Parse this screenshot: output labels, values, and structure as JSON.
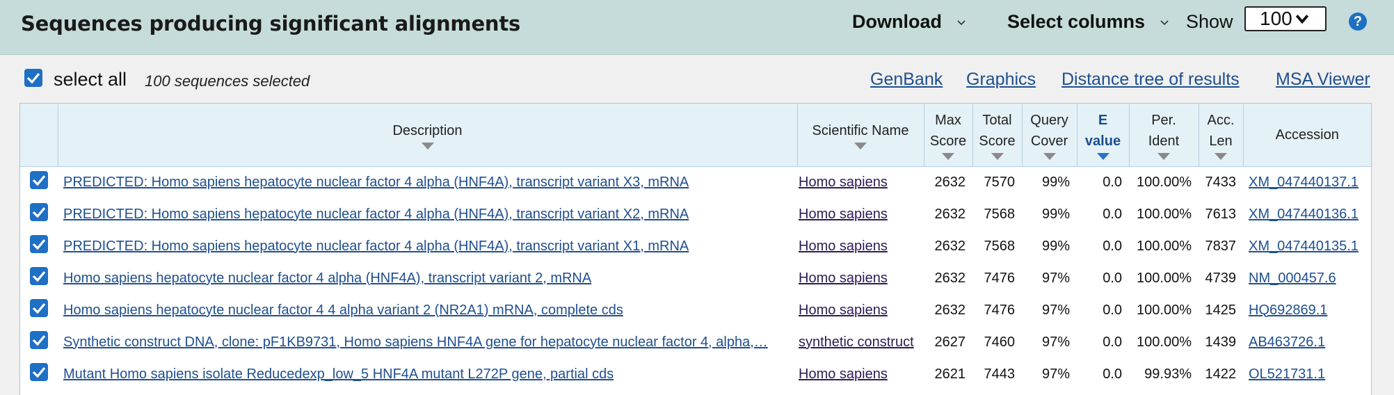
{
  "header": {
    "title": "Sequences producing significant alignments",
    "download_label": "Download",
    "select_columns_label": "Select columns",
    "show_label": "Show",
    "show_value": "100",
    "help_glyph": "?"
  },
  "toolbar": {
    "select_all_label": "select all",
    "selected_count": "100 sequences selected",
    "links": [
      "GenBank",
      "Graphics",
      "Distance tree of results",
      "MSA Viewer"
    ]
  },
  "columns": {
    "description": "Description",
    "scientific_name": "Scientific Name",
    "max_score": [
      "Max",
      "Score"
    ],
    "total_score": [
      "Total",
      "Score"
    ],
    "query_cover": [
      "Query",
      "Cover"
    ],
    "e_value": [
      "E",
      "value"
    ],
    "per_ident": [
      "Per.",
      "Ident"
    ],
    "acc_len": [
      "Acc.",
      "Len"
    ],
    "accession": "Accession"
  },
  "rows": [
    {
      "description": "PREDICTED: Homo sapiens hepatocyte nuclear factor 4 alpha (HNF4A), transcript variant X3, mRNA",
      "sci": "Homo sapiens",
      "max": "2632",
      "total": "7570",
      "cover": "99%",
      "evalue": "0.0",
      "ident": "100.00%",
      "len": "7433",
      "acc": "XM_047440137.1"
    },
    {
      "description": "PREDICTED: Homo sapiens hepatocyte nuclear factor 4 alpha (HNF4A), transcript variant X2, mRNA",
      "sci": "Homo sapiens",
      "max": "2632",
      "total": "7568",
      "cover": "99%",
      "evalue": "0.0",
      "ident": "100.00%",
      "len": "7613",
      "acc": "XM_047440136.1"
    },
    {
      "description": "PREDICTED: Homo sapiens hepatocyte nuclear factor 4 alpha (HNF4A), transcript variant X1, mRNA",
      "sci": "Homo sapiens",
      "max": "2632",
      "total": "7568",
      "cover": "99%",
      "evalue": "0.0",
      "ident": "100.00%",
      "len": "7837",
      "acc": "XM_047440135.1"
    },
    {
      "description": "Homo sapiens hepatocyte nuclear factor 4 alpha (HNF4A), transcript variant 2, mRNA",
      "sci": "Homo sapiens",
      "max": "2632",
      "total": "7476",
      "cover": "97%",
      "evalue": "0.0",
      "ident": "100.00%",
      "len": "4739",
      "acc": "NM_000457.6"
    },
    {
      "description": "Homo sapiens hepatocyte nuclear factor 4 4 alpha variant 2 (NR2A1) mRNA, complete cds",
      "sci": "Homo sapiens",
      "max": "2632",
      "total": "7476",
      "cover": "97%",
      "evalue": "0.0",
      "ident": "100.00%",
      "len": "1425",
      "acc": "HQ692869.1"
    },
    {
      "description": "Synthetic construct DNA, clone: pF1KB9731, Homo sapiens HNF4A gene for hepatocyte nuclear factor 4, alpha,…",
      "sci": "synthetic construct",
      "max": "2627",
      "total": "7460",
      "cover": "97%",
      "evalue": "0.0",
      "ident": "100.00%",
      "len": "1439",
      "acc": "AB463726.1"
    },
    {
      "description": "Mutant Homo sapiens isolate Reducedexp_low_5 HNF4A mutant L272P gene, partial cds",
      "sci": "Homo sapiens",
      "max": "2621",
      "total": "7443",
      "cover": "97%",
      "evalue": "0.0",
      "ident": "99.93%",
      "len": "1422",
      "acc": "OL521731.1"
    }
  ],
  "colors": {
    "header_bg": "#c5dcda",
    "link": "#1e4f91",
    "checkbox": "#1f6fc5",
    "table_header_bg": "#e4f1f6"
  },
  "icons": [
    "chevron-down-icon",
    "checkbox-checked-icon",
    "help-icon",
    "sort-down-icon"
  ]
}
